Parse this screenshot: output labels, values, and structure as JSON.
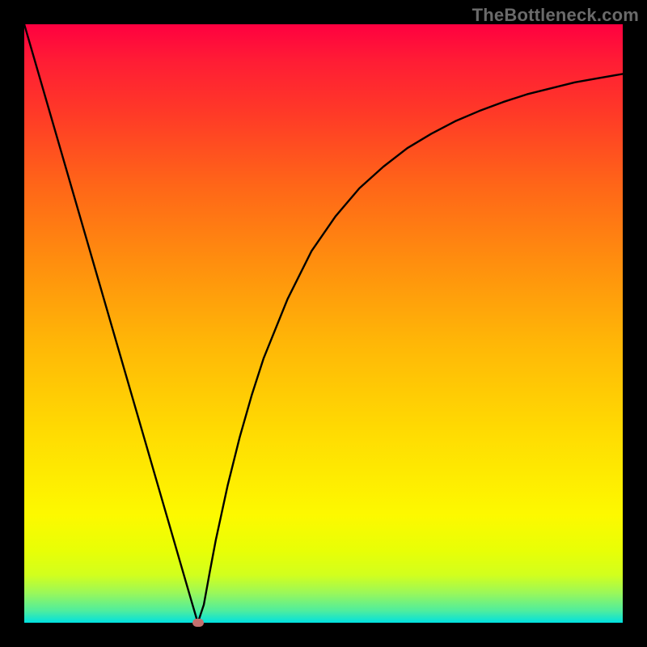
{
  "watermark": "TheBottleneck.com",
  "chart_data": {
    "type": "line",
    "title": "",
    "xlabel": "",
    "ylabel": "",
    "xlim": [
      0,
      100
    ],
    "ylim": [
      0,
      100
    ],
    "x": [
      0,
      2,
      4,
      6,
      8,
      10,
      12,
      14,
      16,
      18,
      20,
      22,
      24,
      26,
      28,
      29,
      30,
      31,
      32,
      34,
      36,
      38,
      40,
      44,
      48,
      52,
      56,
      60,
      64,
      68,
      72,
      76,
      80,
      84,
      88,
      92,
      96,
      100
    ],
    "values": [
      100,
      93.1,
      86.2,
      79.3,
      72.4,
      65.5,
      58.6,
      51.7,
      44.8,
      37.9,
      31.0,
      24.1,
      17.2,
      10.3,
      3.4,
      0.0,
      3.0,
      8.5,
      13.8,
      23.0,
      31.0,
      38.0,
      44.2,
      54.1,
      62.1,
      67.9,
      72.6,
      76.2,
      79.3,
      81.7,
      83.8,
      85.5,
      87.0,
      88.3,
      89.3,
      90.3,
      91.0,
      91.7
    ],
    "marker": {
      "x": 29,
      "y": 0,
      "shape": "pill",
      "color": "#c4706f"
    },
    "background_gradient": [
      "#ff0040",
      "#ff8f0e",
      "#fdf900",
      "#00e0e0"
    ]
  }
}
